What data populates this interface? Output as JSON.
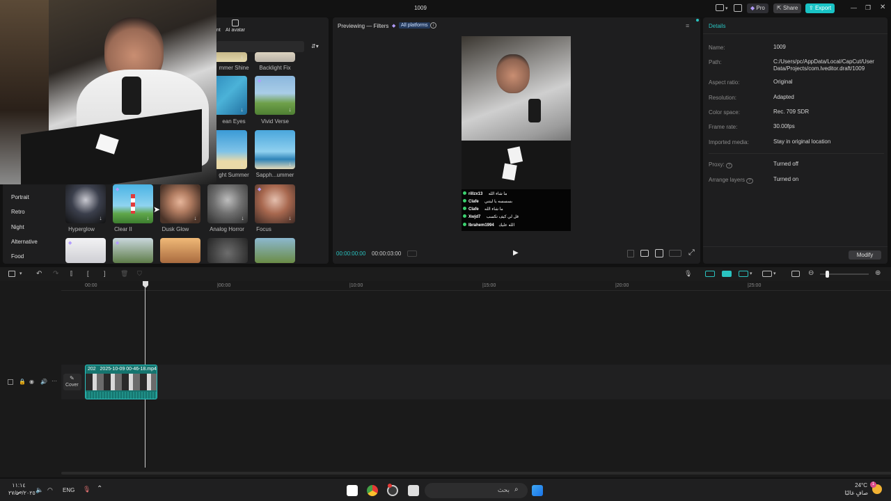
{
  "window": {
    "title": "1009",
    "pro_label": "Pro",
    "share_label": "Share",
    "export_label": "Export"
  },
  "left_panel": {
    "tab_partial": "nt",
    "tab_ai_avatar": "AI avatar",
    "categories": [
      "Portrait",
      "Retro",
      "Night",
      "Alternative",
      "Food"
    ],
    "filters_row0": [
      "mmer Shine",
      "Backlight Fix"
    ],
    "filters_row1": [
      "ean Eyes",
      "Vivid Verse"
    ],
    "filters_row2": [
      "ght Summer",
      "Sapph...ummer"
    ],
    "filters_row3": [
      "Hyperglow",
      "Clear II",
      "Dusk Glow",
      "Analog Horror",
      "Focus"
    ]
  },
  "preview": {
    "title": "Previewing — Filters",
    "platform_badge": "All platforms",
    "time_current": "00:00:00:00",
    "time_total": "00:00:03:00",
    "chat": [
      {
        "user": "rillzx13",
        "msg": "ما شاء الله"
      },
      {
        "user": "Clafe",
        "msg": "بسسسه يا ليتني"
      },
      {
        "user": "Clafe",
        "msg": "ما شاء الله"
      },
      {
        "user": "Xwjd7",
        "msg": "قل لي كيف تكسب"
      },
      {
        "user": "Ibrahem1994",
        "msg": "الله عليك"
      }
    ]
  },
  "details": {
    "header": "Details",
    "rows": [
      {
        "label": "Name:",
        "value": "1009"
      },
      {
        "label": "Path:",
        "value": "C:/Users/pc/AppData/Local/CapCut/User Data/Projects/com.lveditor.draft/1009"
      },
      {
        "label": "Aspect ratio:",
        "value": "Original"
      },
      {
        "label": "Resolution:",
        "value": "Adapted"
      },
      {
        "label": "Color space:",
        "value": "Rec. 709 SDR"
      },
      {
        "label": "Frame rate:",
        "value": "30.00fps"
      },
      {
        "label": "Imported media:",
        "value": "Stay in original location"
      },
      {
        "label": "Proxy:",
        "value": "Turned off"
      },
      {
        "label": "Arrange layers",
        "value": "Turned on"
      }
    ],
    "modify_label": "Modify"
  },
  "timeline": {
    "ticks": [
      "00:00",
      "|00:00",
      "|10:00",
      "|15:00",
      "|20:00",
      "|25:00"
    ],
    "clip_title": "2025-10-09 00-46-18.mp4",
    "clip_prefix": "202",
    "cover_label": "Cover"
  },
  "taskbar": {
    "time": "١١:١٤ ص",
    "date": "٢٧/١٠/٢٠٢٥",
    "lang": "ENG",
    "search_placeholder": "بحث",
    "weather_temp": "24°C",
    "weather_desc": "صافٍ غالبًا",
    "notif_count": "1"
  },
  "colors": {
    "accent": "#2ac3c0",
    "clip": "#16756f",
    "export": "#19c3c5"
  }
}
